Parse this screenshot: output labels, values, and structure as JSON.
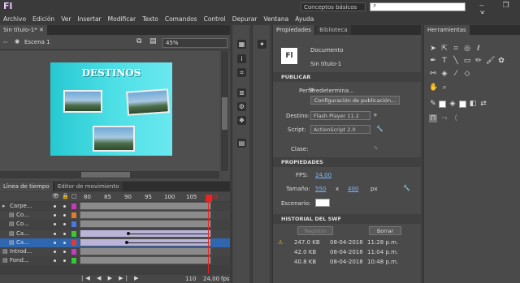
{
  "app": {
    "logo": "Fl",
    "workspace": "Conceptos básicos",
    "window_controls": "‒ ❐ ✕"
  },
  "menu": [
    "Archivo",
    "Edición",
    "Ver",
    "Insertar",
    "Modificar",
    "Texto",
    "Comandos",
    "Control",
    "Depurar",
    "Ventana",
    "Ayuda"
  ],
  "document": {
    "tab": "Sin título-1*",
    "scene": "Escena 1",
    "zoom": "45%",
    "stage_title": "DESTINOS"
  },
  "timeline": {
    "tabs": [
      "Línea de tiempo",
      "Editor de movimiento"
    ],
    "ruler": [
      "80",
      "85",
      "90",
      "95",
      "100",
      "105",
      "110"
    ],
    "layers": [
      {
        "name": "Carpe...",
        "color": "#c23cc2"
      },
      {
        "name": "Co...",
        "color": "#e07b2a"
      },
      {
        "name": "Co...",
        "color": "#4a78e0"
      },
      {
        "name": "Ca...",
        "color": "#37c837"
      },
      {
        "name": "Ca...",
        "color": "#e03a3a"
      },
      {
        "name": "Introd...",
        "color": "#c23cc2"
      },
      {
        "name": "Fond...",
        "color": "#37c837"
      }
    ],
    "footer": {
      "frame": "110",
      "fps": "24,00",
      "fps_unit": "fps"
    }
  },
  "properties": {
    "tabs": [
      "Propiedades",
      "Biblioteca"
    ],
    "doc_type": "Documento",
    "doc_name": "Sin título-1",
    "publish_header": "PUBLICAR",
    "profile_label": "Perfil:",
    "profile_value": "Predetermina...",
    "publish_settings_button": "Configuración de publicación...",
    "target_label": "Destino:",
    "target_value": "Flash Player 11.2",
    "script_label": "Script:",
    "script_value": "ActionScript 2.0",
    "class_label": "Clase:",
    "props_header": "PROPIEDADES",
    "fps_label": "FPS:",
    "fps_value": "24,00",
    "size_label": "Tamaño:",
    "width_value": "550",
    "x_label": "x",
    "height_value": "400",
    "px_label": "px",
    "stage_label": "Escenario:",
    "history_header": "HISTORIAL DEL SWF",
    "register_button": "Registro",
    "clear_button": "Borrar",
    "history": [
      {
        "size": "247.0 KB",
        "date": "08-04-2018",
        "time": "11:28 p.m."
      },
      {
        "size": "42.0 KB",
        "date": "08-04-2018",
        "time": "11:04 p.m."
      },
      {
        "size": "40.8 KB",
        "date": "08-04-2018",
        "time": "10:48 p.m."
      }
    ]
  },
  "tools": {
    "tab": "Herramientas"
  }
}
